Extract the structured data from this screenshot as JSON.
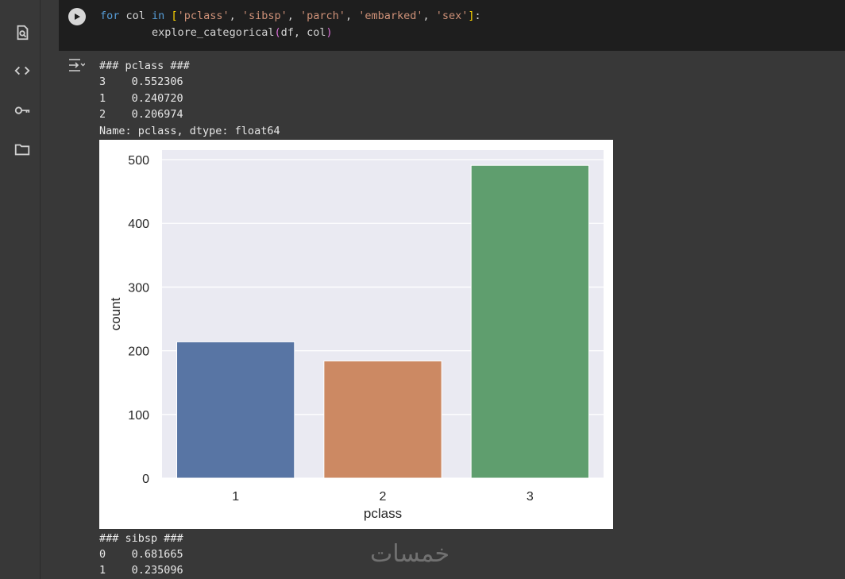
{
  "sidebar": {
    "icons": [
      "search-doc-icon",
      "code-icon",
      "key-icon",
      "folder-icon"
    ]
  },
  "code_cell": {
    "line1_for": "for",
    "line1_col": " col ",
    "line1_in": "in",
    "line1_open": " [",
    "strings": [
      "'pclass'",
      "'sibsp'",
      "'parch'",
      "'embarked'",
      "'sex'"
    ],
    "line1_close": "]",
    "line1_colon": ":",
    "line2": "    explore_categorical(df, col)",
    "line2_fn": "explore_categorical",
    "line2_args": "df, col"
  },
  "output": {
    "pclass_header": "### pclass ###",
    "pclass_rows": [
      "3    0.552306",
      "1    0.240720",
      "2    0.206974"
    ],
    "pclass_footer": "Name: pclass, dtype: float64",
    "sibsp_header": "### sibsp ###",
    "sibsp_rows": [
      "0    0.681665",
      "1    0.235096"
    ]
  },
  "watermark": "خمسات",
  "chart_data": {
    "type": "bar",
    "categories": [
      "1",
      "2",
      "3"
    ],
    "values": [
      214,
      184,
      491
    ],
    "colors": [
      "#5875a4",
      "#cc8963",
      "#5f9e6e"
    ],
    "xlabel": "pclass",
    "ylabel": "count",
    "yticks": [
      0,
      100,
      200,
      300,
      400,
      500
    ],
    "ylim": [
      0,
      515
    ],
    "background": "#eaeaf2",
    "grid": true
  }
}
